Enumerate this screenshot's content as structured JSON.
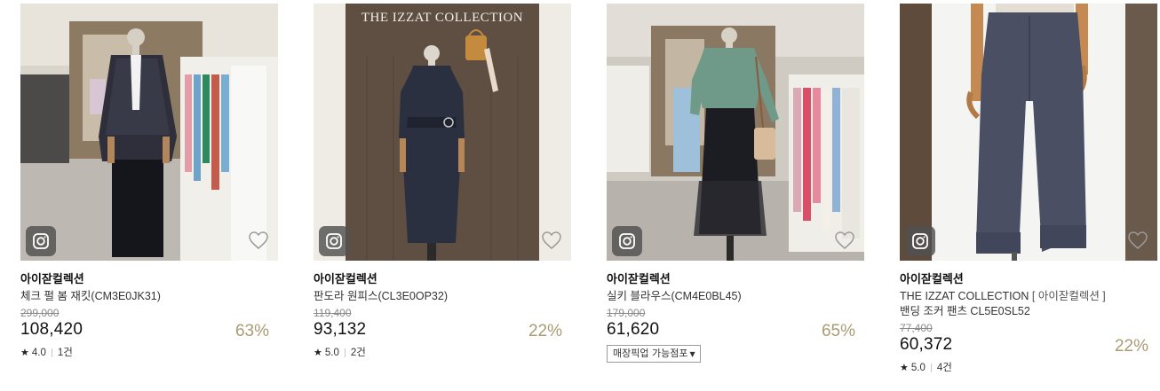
{
  "products": [
    {
      "brand": "아이잗컬렉션",
      "name": "체크 펄 봄 재킷(CM3E0JK31)",
      "original_price": "299,000",
      "price": "108,420",
      "discount": "63%",
      "rating": "4.0",
      "reviews": "1건"
    },
    {
      "brand": "아이잗컬렉션",
      "name": "판도라 원피스(CL3E0OP32)",
      "original_price": "119,400",
      "price": "93,132",
      "discount": "22%",
      "rating": "5.0",
      "reviews": "2건",
      "photo_sign": "THE IZZAT COLLECTION"
    },
    {
      "brand": "아이잗컬렉션",
      "name": "실키 블라우스(CM4E0BL45)",
      "original_price": "179,000",
      "price": "61,620",
      "discount": "65%",
      "pickup_label": "매장픽업 가능점포"
    },
    {
      "brand": "아이잗컬렉션",
      "name": "THE IZZAT COLLECTION",
      "name_option": "[ 아이잗컬렉션 ]",
      "name_line2": "밴딩 조커 팬츠 CL5E0SL52",
      "original_price": "77,400",
      "price": "60,372",
      "discount": "22%",
      "rating": "5.0",
      "reviews": "4건"
    }
  ],
  "icons": {
    "image_badge": "instagram-icon",
    "wishlist": "heart-outline-icon",
    "rating": "star-icon",
    "dropdown": "caret-down-icon"
  },
  "colors": {
    "discount": "#a99b72",
    "price": "#111111",
    "original_price": "#8a8a8a"
  }
}
